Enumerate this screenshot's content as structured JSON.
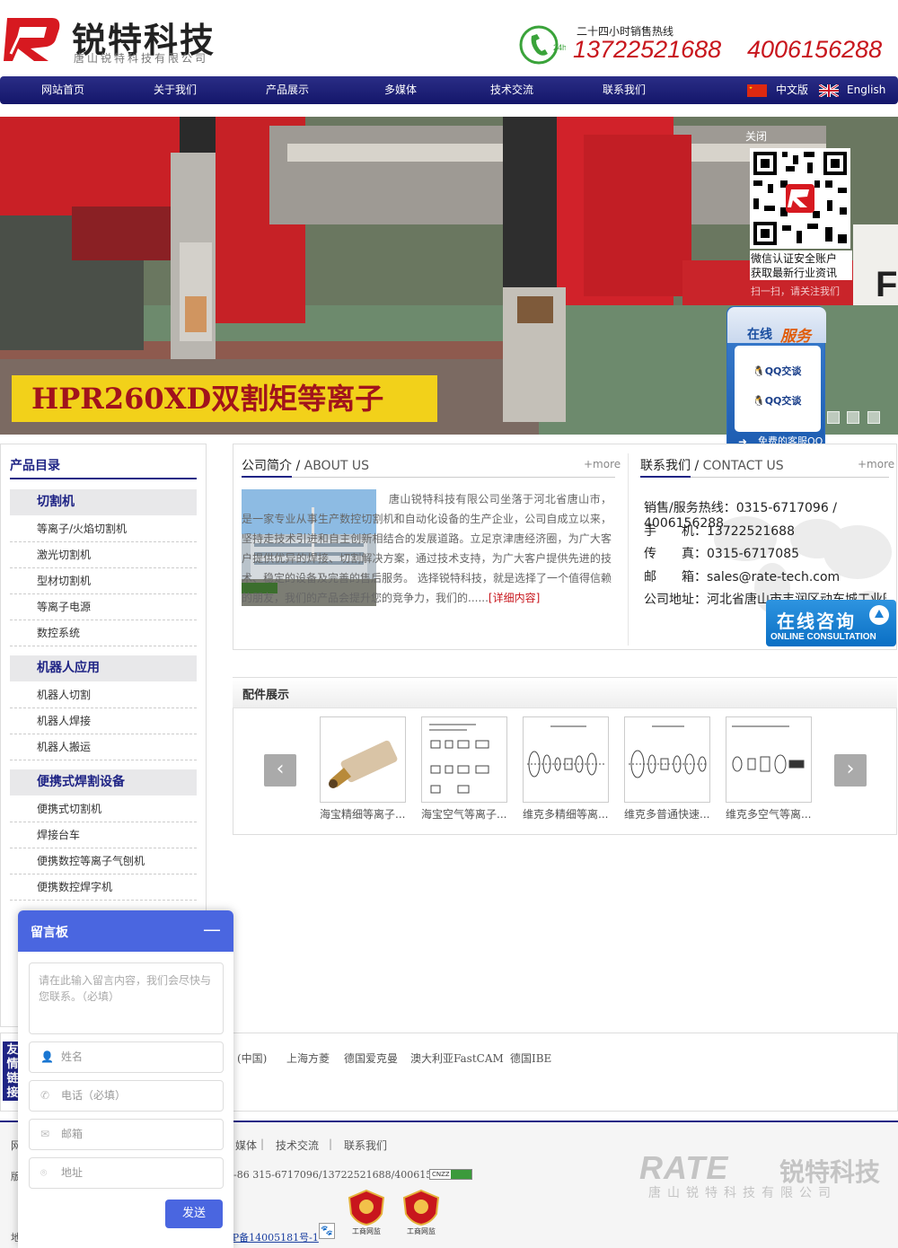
{
  "header": {
    "logo_name": "锐特科技",
    "logo_sub": "唐山锐特科技有限公司",
    "hotline_label": "二十四小时销售热线",
    "phone1": "13722521688",
    "phone2": "4006156288",
    "badge_24h": "24h"
  },
  "nav": {
    "items": [
      "网站首页",
      "关于我们",
      "产品展示",
      "多媒体",
      "技术交流",
      "联系我们"
    ],
    "lang_cn": "中文版",
    "lang_en": "English"
  },
  "banner": {
    "caption": "HPR260XD双割矩等离子",
    "right_letter": "F"
  },
  "qr": {
    "close": "关闭",
    "line1": "微信认证安全账户",
    "line2": "获取最新行业资讯",
    "foot": "扫一扫，请关注我们"
  },
  "qq": {
    "head1": "在线",
    "head2": "服务",
    "item1": "QQ交谈",
    "item2": "QQ交谈",
    "foot": "免费的客服QQ"
  },
  "sidebar": {
    "title": "产品目录",
    "groups": [
      {
        "name": "切割机",
        "items": [
          "等离子/火焰切割机",
          "激光切割机",
          "型材切割机",
          "等离子电源",
          "数控系统"
        ]
      },
      {
        "name": "机器人应用",
        "items": [
          "机器人切割",
          "机器人焊接",
          "机器人搬运"
        ]
      },
      {
        "name": "便携式焊割设备",
        "items": [
          "便携式切割机",
          "焊接台车",
          "便携数控等离子气刨机",
          "便携数控焊字机"
        ]
      }
    ]
  },
  "about": {
    "title": "公司简介",
    "title_en": "ABOUT US",
    "more": "+more",
    "text": "唐山锐特科技有限公司坐落于河北省唐山市，是一家专业从事生产数控切割机和自动化设备的生产企业，公司自成立以来，坚持走技术引进和自主创新相结合的发展道路。立足京津唐经济圈，为广大客户提供优异的焊接、切割解决方案，通过技术支持，为广大客户提供先进的技术、稳定的设备及完善的售后服务。 选择锐特科技，就是选择了一个值得信赖的朋友，我们的产品会提升您的竞争力，我们的......",
    "detail": "[详细内容]"
  },
  "contact": {
    "title": "联系我们",
    "title_en": "CONTACT US",
    "more": "+more",
    "lines": [
      "销售/服务热线：0315-6717096 / 4006156288",
      "手　　机：13722521688",
      "传　　真：0315-6717085",
      "邮　　箱：sales@rate-tech.com",
      "公司地址：河北省唐山市丰润区动车城工业园"
    ],
    "consult_cn": "在线咨询",
    "consult_en": "ONLINE CONSULTATION"
  },
  "parts": {
    "title": "配件展示",
    "prev": "‹",
    "next": "›",
    "items": [
      "海宝精细等离子...",
      "海宝空气等离子...",
      "维克多精细等离...",
      "维克多普通快速...",
      "维克多空气等离..."
    ]
  },
  "friends": {
    "label": "友情链接",
    "links": [
      "(中国)",
      "上海方菱",
      "德国爱克曼",
      "澳大利亚FastCAM",
      "德国IBE"
    ]
  },
  "footer": {
    "nav": [
      "网",
      "媒体",
      "技术交流",
      "联系我们"
    ],
    "sep": "|",
    "copy_prefix": "版",
    "phones": "-86 315-6717096/13722521688/4006156288",
    "cnzz": "CNZZ",
    "address_prefix": "地址：",
    "icp": "冀ICP备14005181号-1",
    "badge_text": "工商网监",
    "logo_en": "RATE",
    "logo_cn": "锐特科技",
    "logo_sub": "唐山锐特科技有限公司"
  },
  "message": {
    "title": "留言板",
    "minimize": "—",
    "content_placeholder": "请在此输入留言内容，我们会尽快与您联系。（必填）",
    "name": "姓名",
    "phone": "电话（必填）",
    "email": "邮箱",
    "address": "地址",
    "send": "发送"
  },
  "colors": {
    "brand_red": "#c8161d",
    "nav_blue": "#1f2485",
    "message_blue": "#4a66e0"
  }
}
